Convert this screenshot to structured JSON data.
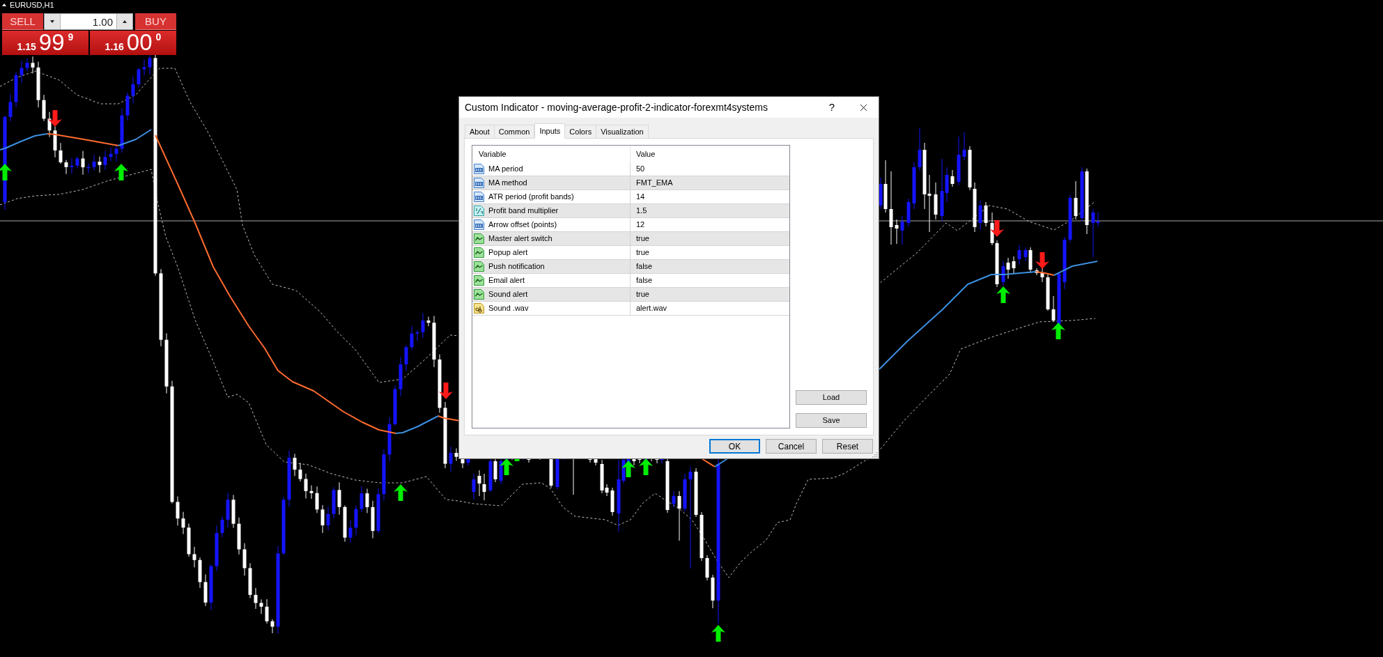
{
  "chart": {
    "symbol": "EURUSD,H1"
  },
  "trade_panel": {
    "sell": {
      "label": "SELL",
      "price_prefix": "1.15",
      "price_main": "99",
      "price_suffix": "9"
    },
    "lot": {
      "value": "1.00"
    },
    "buy": {
      "label": "BUY",
      "price_prefix": "1.16",
      "price_main": "00",
      "price_suffix": "0"
    }
  },
  "dialog": {
    "title": "Custom Indicator - moving-average-profit-2-indicator-forexmt4systems",
    "help": "?",
    "tabs": [
      {
        "label": "About",
        "selected": false
      },
      {
        "label": "Common",
        "selected": false
      },
      {
        "label": "Inputs",
        "selected": true
      },
      {
        "label": "Colors",
        "selected": false
      },
      {
        "label": "Visualization",
        "selected": false
      }
    ],
    "inputs_table": {
      "columns": [
        "Variable",
        "Value"
      ],
      "rows": [
        {
          "kind": "int",
          "variable": "MA period",
          "value": "50"
        },
        {
          "kind": "int",
          "variable": "MA method",
          "value": "FMT_EMA"
        },
        {
          "kind": "int",
          "variable": "ATR period (profit bands)",
          "value": "14"
        },
        {
          "kind": "double",
          "variable": "Profit band multiplier",
          "value": "1.5"
        },
        {
          "kind": "int",
          "variable": "Arrow offset (points)",
          "value": "12"
        },
        {
          "kind": "bool",
          "variable": "Master alert switch",
          "value": "true"
        },
        {
          "kind": "bool",
          "variable": "Popup alert",
          "value": "true"
        },
        {
          "kind": "bool",
          "variable": "Push notification",
          "value": "false"
        },
        {
          "kind": "bool",
          "variable": "Email alert",
          "value": "false"
        },
        {
          "kind": "bool",
          "variable": "Sound alert",
          "value": "true"
        },
        {
          "kind": "string",
          "variable": "Sound .wav",
          "value": "alert.wav"
        }
      ]
    },
    "side_buttons": [
      "Load",
      "Save"
    ],
    "buttons": [
      {
        "label": "OK",
        "focused": true
      },
      {
        "label": "Cancel",
        "focused": false
      },
      {
        "label": "Reset",
        "focused": false
      }
    ]
  }
}
